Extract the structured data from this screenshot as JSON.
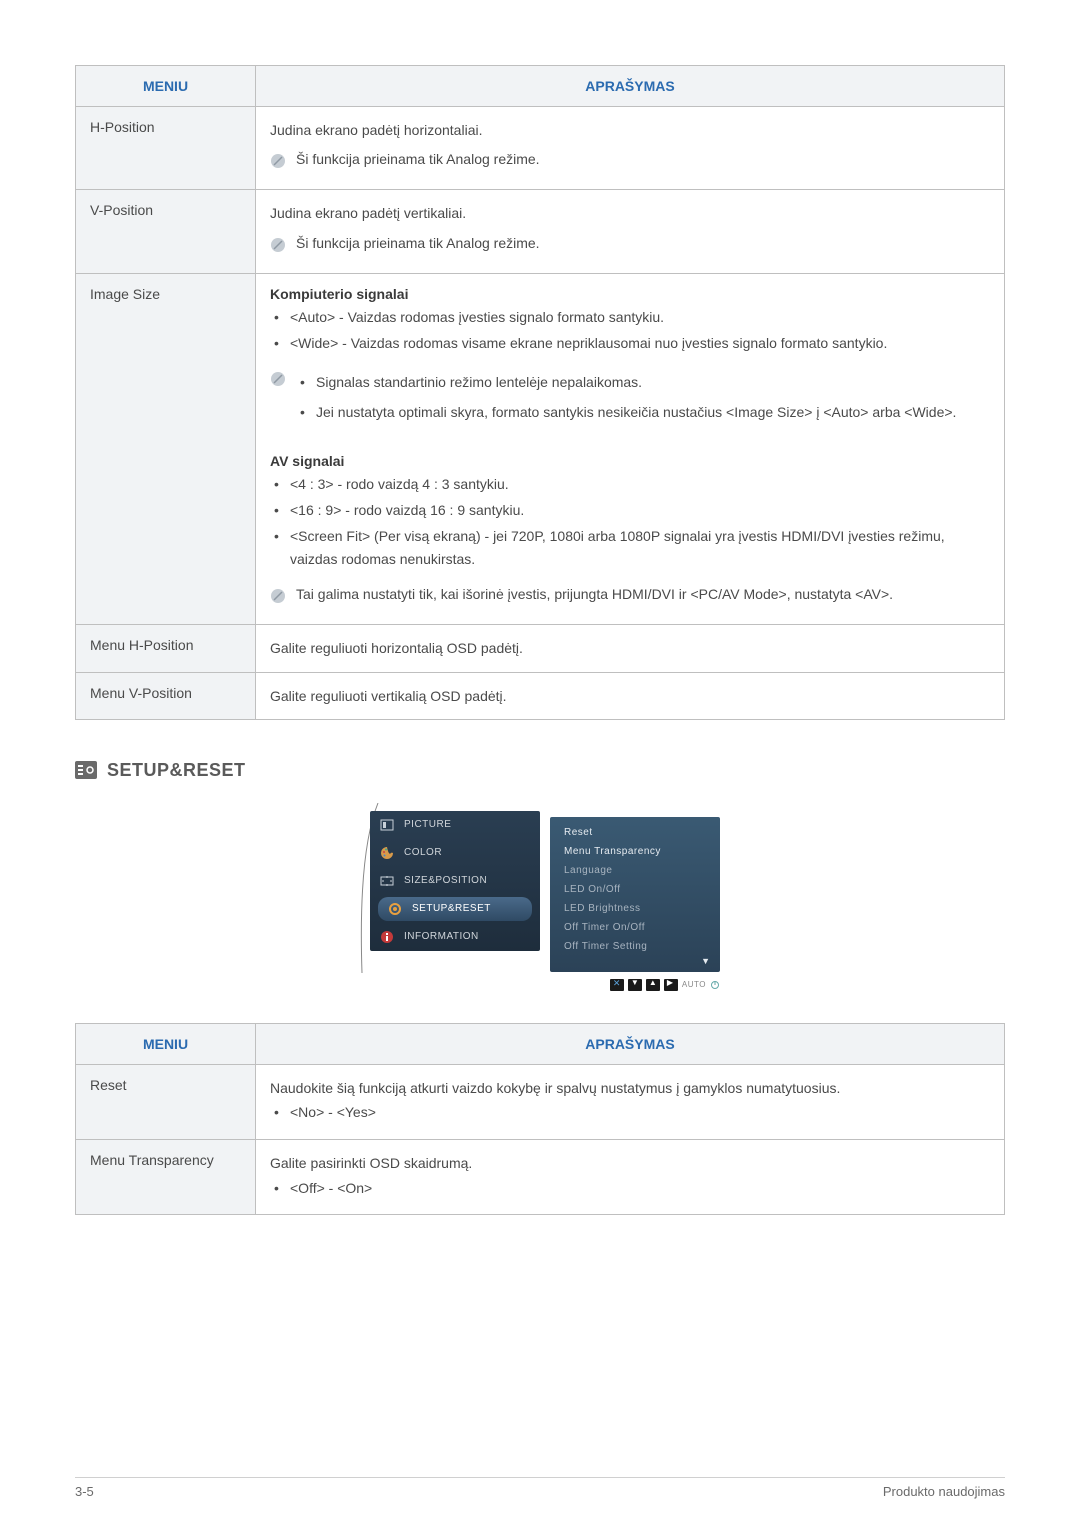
{
  "table1": {
    "headers": {
      "menu": "MENIU",
      "desc": "APRAŠYMAS"
    },
    "rows": {
      "hpos": {
        "menu": "H-Position",
        "desc": "Judina ekrano padėtį horizontaliai.",
        "note": "Ši funkcija prieinama tik Analog režime."
      },
      "vpos": {
        "menu": "V-Position",
        "desc": "Judina ekrano padėtį vertikaliai.",
        "note": "Ši funkcija prieinama tik Analog režime."
      },
      "imagesize": {
        "menu": "Image Size",
        "heading1": "Kompiuterio signalai",
        "b1": "<Auto> - Vaizdas rodomas įvesties signalo formato santykiu.",
        "b2": "<Wide> - Vaizdas rodomas visame ekrane nepriklausomai nuo įvesties signalo formato santykio.",
        "note1_b1": "Signalas standartinio režimo lentelėje nepalaikomas.",
        "note1_b2": "Jei nustatyta optimali skyra, formato santykis nesikeičia nustačius <Image Size> į <Auto> arba <Wide>.",
        "heading2": "AV signalai",
        "b3": "<4 : 3> - rodo vaizdą 4 : 3 santykiu.",
        "b4": "<16 : 9> - rodo vaizdą 16 : 9 santykiu.",
        "b5": "<Screen Fit> (Per visą ekraną) - jei 720P, 1080i arba 1080P signalai yra įvestis HDMI/DVI įvesties režimu, vaizdas rodomas nenukirstas.",
        "note2": "Tai galima nustatyti tik, kai išorinė įvestis, prijungta HDMI/DVI ir <PC/AV Mode>, nustatyta <AV>."
      },
      "menuh": {
        "menu": "Menu H-Position",
        "desc": "Galite reguliuoti horizontalią OSD padėtį."
      },
      "menuv": {
        "menu": "Menu V-Position",
        "desc": "Galite reguliuoti vertikalią OSD padėtį."
      }
    }
  },
  "section2": {
    "heading": "SETUP&RESET"
  },
  "osd": {
    "left": {
      "picture": "PICTURE",
      "color": "COLOR",
      "sizepos": "SIZE&POSITION",
      "setup": "SETUP&RESET",
      "info": "INFORMATION"
    },
    "right": {
      "reset": "Reset",
      "menutrans": "Menu Transparency",
      "lang": "Language",
      "led": "LED On/Off",
      "ledbright": "LED Brightness",
      "offtimer": "Off Timer On/Off",
      "offtimerset": "Off Timer Setting"
    },
    "bottom_auto": "AUTO"
  },
  "table2": {
    "headers": {
      "menu": "MENIU",
      "desc": "APRAŠYMAS"
    },
    "rows": {
      "reset": {
        "menu": "Reset",
        "desc": "Naudokite šią funkciją atkurti vaizdo kokybę ir spalvų nustatymus į gamyklos numatytuosius.",
        "b1": "<No> - <Yes>"
      },
      "menutrans": {
        "menu": "Menu Transparency",
        "desc": "Galite pasirinkti OSD skaidrumą.",
        "b1": "<Off> - <On>"
      }
    }
  },
  "footer": {
    "left": "3-5",
    "right": "Produkto naudojimas"
  }
}
